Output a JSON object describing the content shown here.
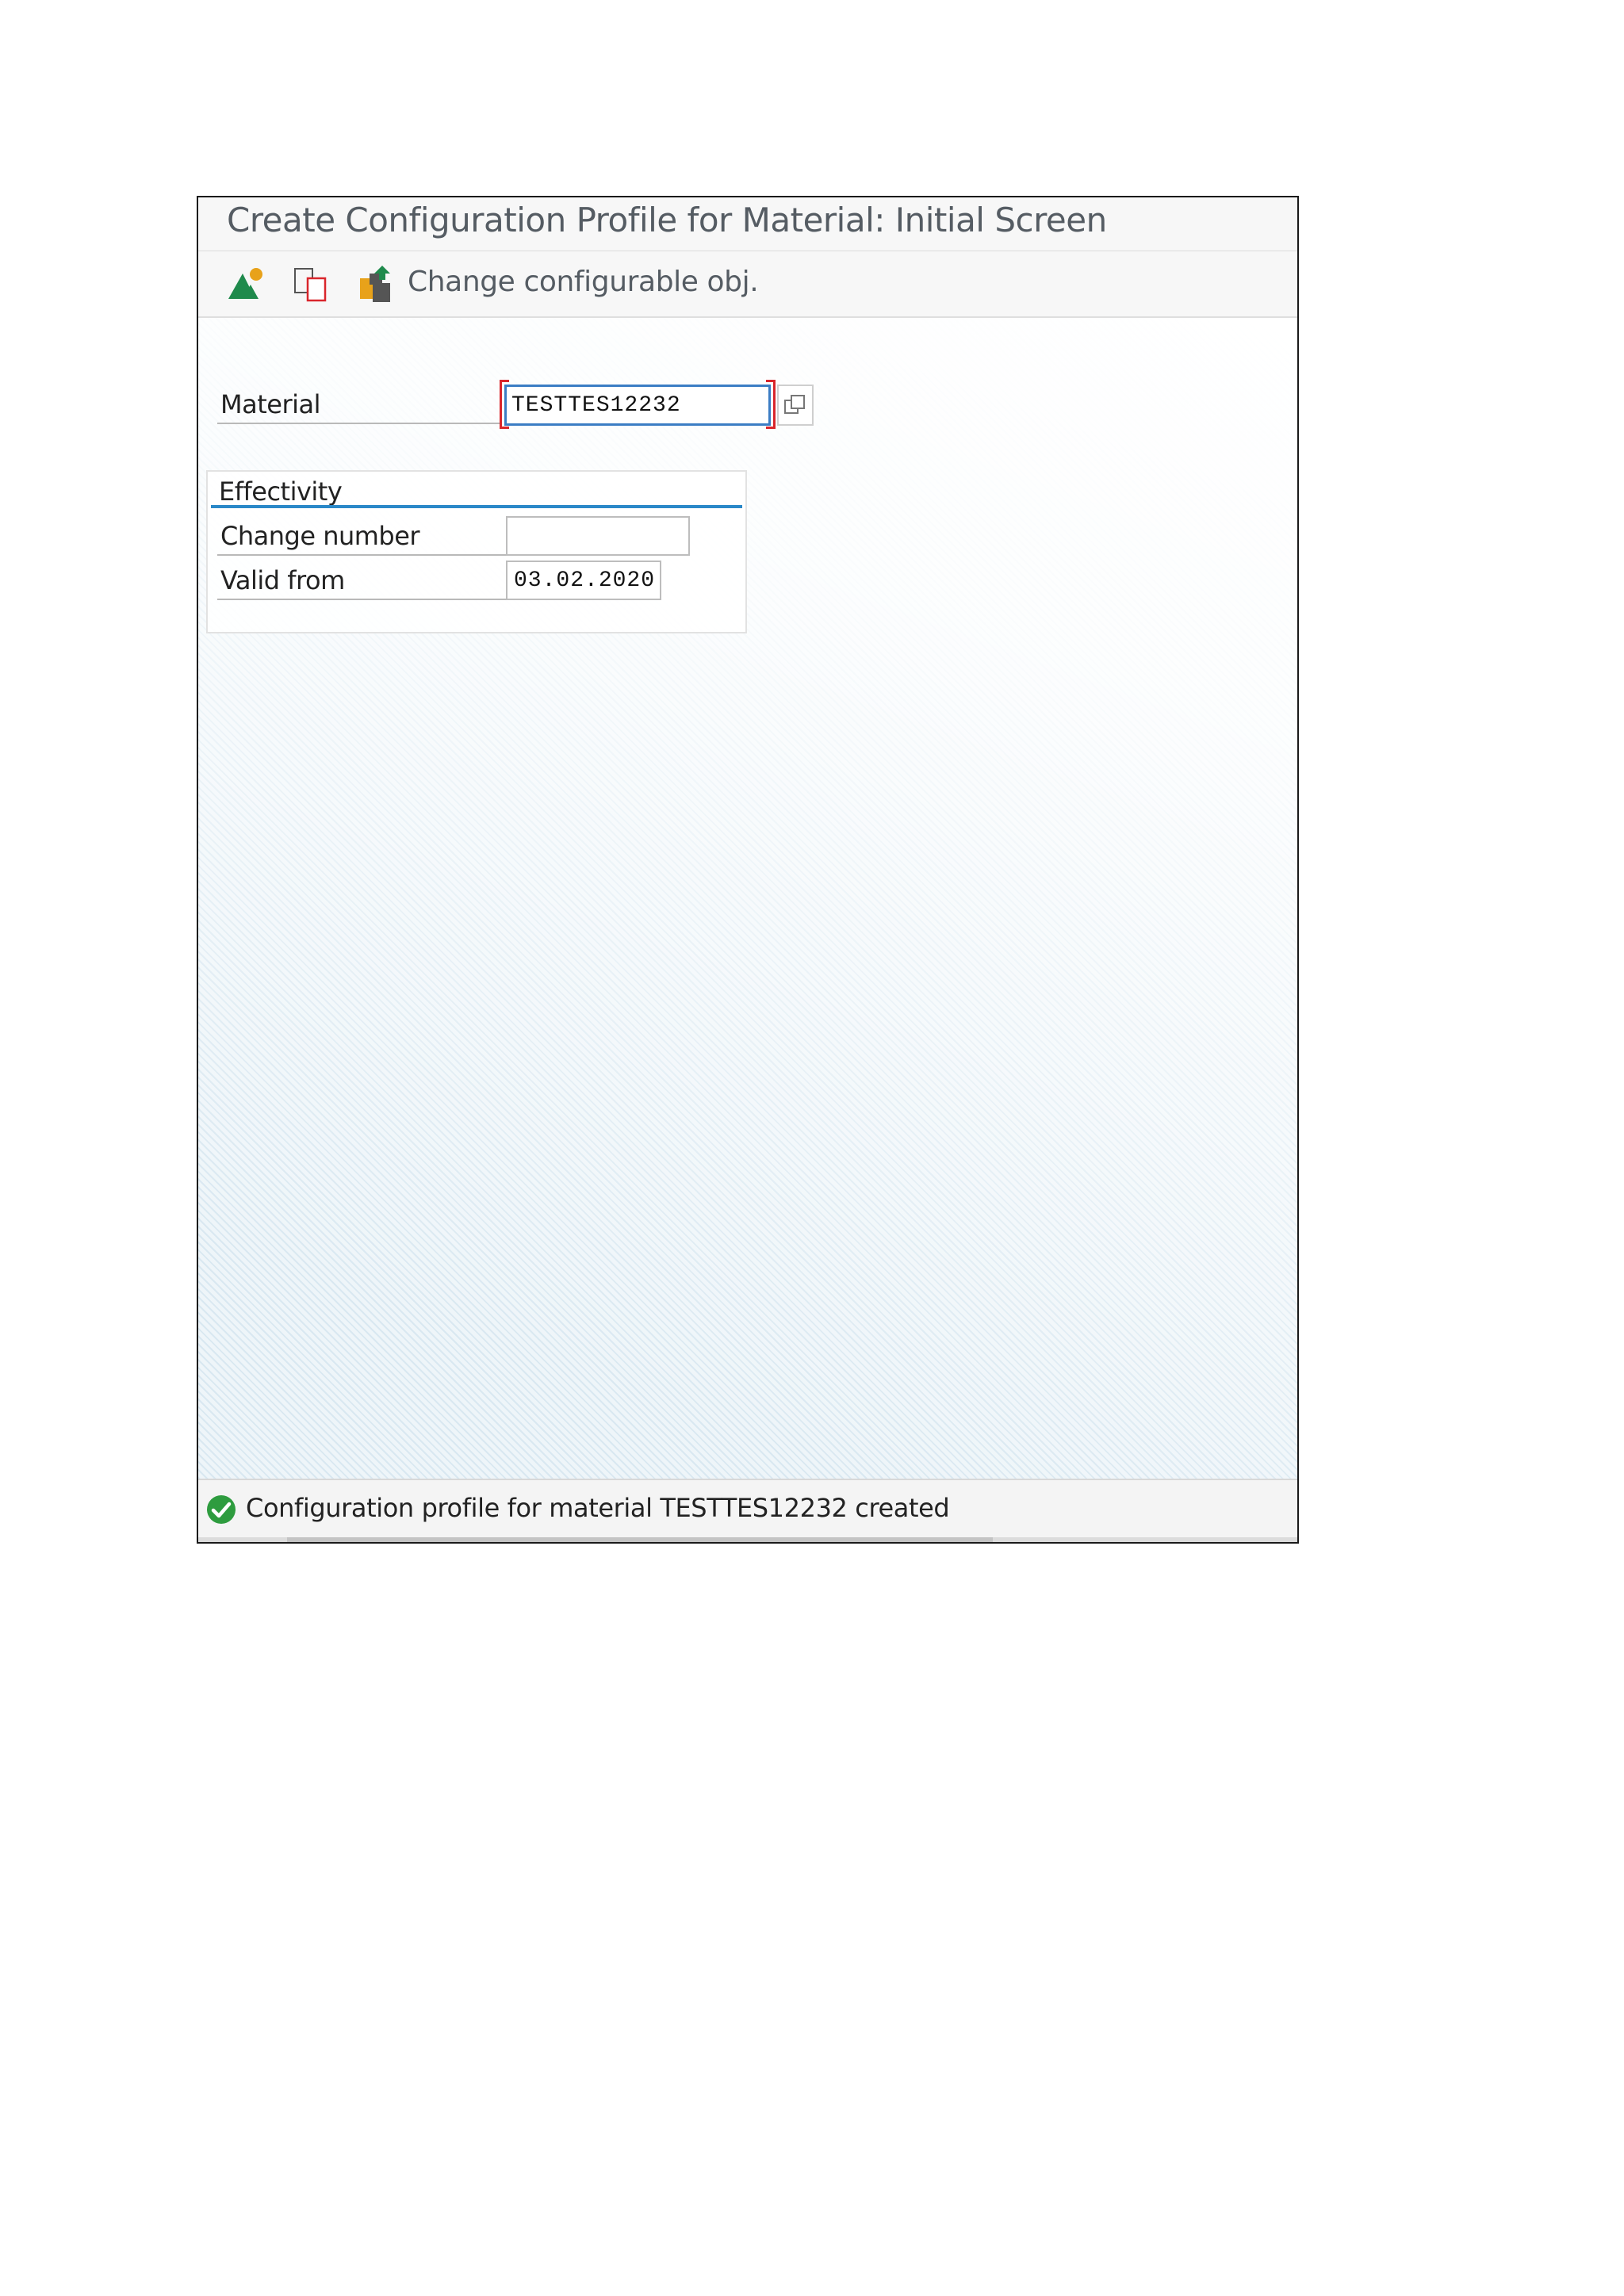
{
  "window": {
    "title": "Create Configuration Profile for Material: Initial Screen"
  },
  "toolbar": {
    "icons": [
      "classification-icon",
      "copy-icon",
      "configurable-object-icon"
    ],
    "change_configurable_label": "Change configurable obj."
  },
  "form": {
    "material_label": "Material",
    "material_value": "TESTTES12232",
    "effectivity": {
      "title": "Effectivity",
      "change_number_label": "Change number",
      "change_number_value": "",
      "valid_from_label": "Valid from",
      "valid_from_value": "03.02.2020"
    }
  },
  "status": {
    "type": "success",
    "message": "Configuration profile for material TESTTES12232 created"
  },
  "colors": {
    "success_green": "#2e9c3f",
    "focus_blue": "#3b7dc4",
    "required_red": "#d9262c",
    "group_line_blue": "#2a88c8"
  }
}
